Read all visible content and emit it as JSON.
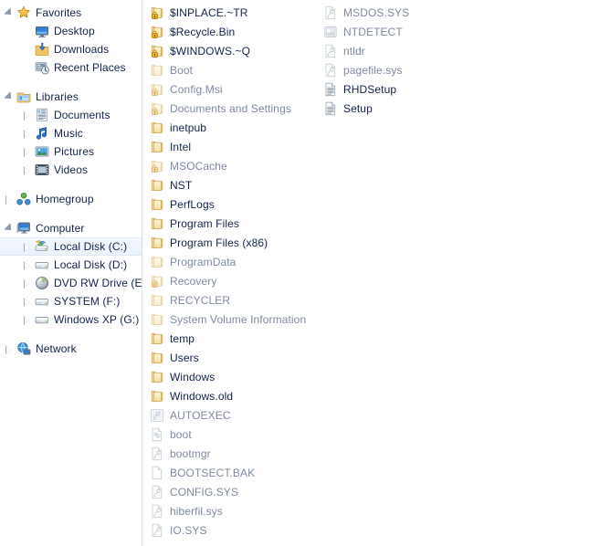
{
  "window": {
    "title": "Local Disk (C:)"
  },
  "nav": {
    "groups": [
      {
        "header": {
          "label": "Favorites",
          "icon": "star-icon",
          "state": "expanded"
        },
        "items": [
          {
            "label": "Desktop",
            "icon": "desktop-icon",
            "state": "none"
          },
          {
            "label": "Downloads",
            "icon": "downloads-icon",
            "state": "none"
          },
          {
            "label": "Recent Places",
            "icon": "recent-places-icon",
            "state": "none"
          }
        ]
      },
      {
        "header": {
          "label": "Libraries",
          "icon": "libraries-icon",
          "state": "expanded"
        },
        "items": [
          {
            "label": "Documents",
            "icon": "documents-library-icon",
            "state": "collapsed"
          },
          {
            "label": "Music",
            "icon": "music-library-icon",
            "state": "collapsed"
          },
          {
            "label": "Pictures",
            "icon": "pictures-library-icon",
            "state": "collapsed"
          },
          {
            "label": "Videos",
            "icon": "videos-library-icon",
            "state": "collapsed"
          }
        ]
      },
      {
        "header": {
          "label": "Homegroup",
          "icon": "homegroup-icon",
          "state": "collapsed"
        },
        "items": []
      },
      {
        "header": {
          "label": "Computer",
          "icon": "computer-icon",
          "state": "expanded"
        },
        "items": [
          {
            "label": "Local Disk (C:)",
            "icon": "system-drive-icon",
            "state": "collapsed",
            "selected": true
          },
          {
            "label": "Local Disk (D:)",
            "icon": "drive-icon",
            "state": "collapsed"
          },
          {
            "label": "DVD RW Drive (E:) R",
            "icon": "dvd-drive-icon",
            "state": "collapsed"
          },
          {
            "label": "SYSTEM (F:)",
            "icon": "drive-icon",
            "state": "collapsed"
          },
          {
            "label": "Windows XP (G:)",
            "icon": "drive-icon",
            "state": "collapsed"
          }
        ]
      },
      {
        "header": {
          "label": "Network",
          "icon": "network-icon",
          "state": "collapsed"
        },
        "items": []
      }
    ]
  },
  "content": {
    "columns": [
      {
        "items": [
          {
            "name": "$INPLACE.~TR",
            "icon": "locked-folder-icon",
            "dim": false
          },
          {
            "name": "$Recycle.Bin",
            "icon": "locked-folder-icon",
            "dim": false
          },
          {
            "name": "$WINDOWS.~Q",
            "icon": "locked-folder-icon",
            "dim": false
          },
          {
            "name": "Boot",
            "icon": "folder-icon",
            "dim": true
          },
          {
            "name": "Config.Msi",
            "icon": "locked-folder-icon",
            "dim": true
          },
          {
            "name": "Documents and Settings",
            "icon": "locked-folder-icon",
            "dim": true
          },
          {
            "name": "inetpub",
            "icon": "folder-icon",
            "dim": false
          },
          {
            "name": "Intel",
            "icon": "folder-icon",
            "dim": false
          },
          {
            "name": "MSOCache",
            "icon": "locked-folder-icon",
            "dim": true
          },
          {
            "name": "NST",
            "icon": "folder-icon",
            "dim": false
          },
          {
            "name": "PerfLogs",
            "icon": "folder-icon",
            "dim": false
          },
          {
            "name": "Program Files",
            "icon": "folder-icon",
            "dim": false
          },
          {
            "name": "Program Files (x86)",
            "icon": "folder-icon",
            "dim": false
          },
          {
            "name": "ProgramData",
            "icon": "folder-icon",
            "dim": true
          },
          {
            "name": "Recovery",
            "icon": "locked-folder-icon",
            "dim": true
          },
          {
            "name": "RECYCLER",
            "icon": "folder-icon",
            "dim": true
          },
          {
            "name": "System Volume Information",
            "icon": "folder-icon",
            "dim": true
          },
          {
            "name": "temp",
            "icon": "folder-icon",
            "dim": false
          },
          {
            "name": "Users",
            "icon": "folder-icon",
            "dim": false
          },
          {
            "name": "Windows",
            "icon": "folder-icon",
            "dim": false
          },
          {
            "name": "Windows.old",
            "icon": "folder-icon",
            "dim": false
          },
          {
            "name": "AUTOEXEC",
            "icon": "batch-file-icon",
            "dim": true
          },
          {
            "name": "boot",
            "icon": "config-file-icon",
            "dim": true
          },
          {
            "name": "bootmgr",
            "icon": "system-file-icon",
            "dim": true
          },
          {
            "name": "BOOTSECT.BAK",
            "icon": "blank-file-icon",
            "dim": true
          },
          {
            "name": "CONFIG.SYS",
            "icon": "system-file-icon",
            "dim": true
          },
          {
            "name": "hiberfil.sys",
            "icon": "system-file-icon",
            "dim": true
          },
          {
            "name": "IO.SYS",
            "icon": "system-file-icon",
            "dim": true
          }
        ]
      },
      {
        "items": [
          {
            "name": "MSDOS.SYS",
            "icon": "system-file-icon",
            "dim": true
          },
          {
            "name": "NTDETECT",
            "icon": "application-icon",
            "dim": true
          },
          {
            "name": "ntldr",
            "icon": "system-file-icon",
            "dim": true
          },
          {
            "name": "pagefile.sys",
            "icon": "system-file-icon",
            "dim": true
          },
          {
            "name": "RHDSetup",
            "icon": "text-file-icon",
            "dim": false
          },
          {
            "name": "Setup",
            "icon": "text-file-icon",
            "dim": false
          }
        ]
      }
    ]
  },
  "colors": {
    "text": "#11224d",
    "text_dim": "#7e8aa0",
    "folder": "#f6d98b",
    "folder_edge": "#d9a93c",
    "selection": "#eaf2fb",
    "divider": "#d9e2ef",
    "background": "#ffffff"
  }
}
